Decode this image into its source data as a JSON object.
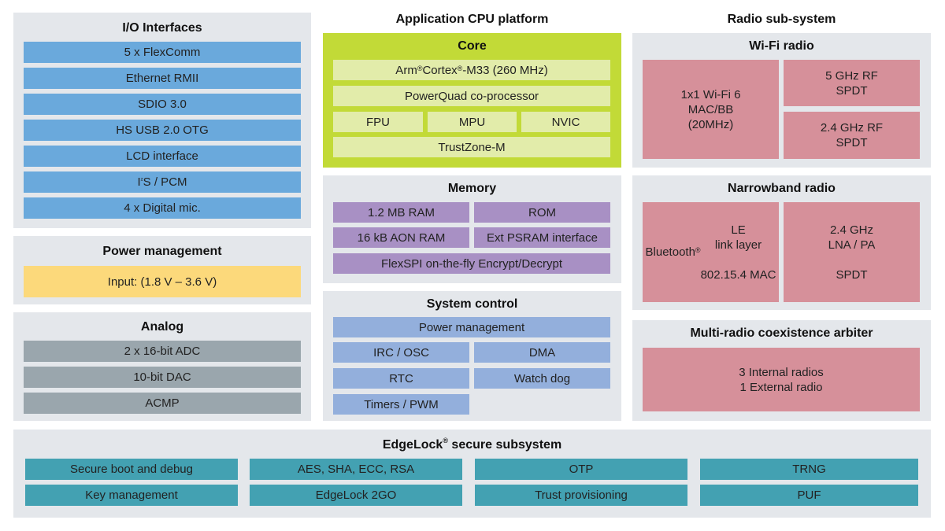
{
  "columns": {
    "middle_title": "Application CPU platform",
    "right_title": "Radio sub-system"
  },
  "io_interfaces": {
    "title": "I/O Interfaces",
    "items": [
      "5 x FlexComm",
      "Ethernet RMII",
      "SDIO 3.0",
      "HS USB 2.0 OTG",
      "LCD interface",
      "I²S / PCM",
      "4 x Digital mic."
    ]
  },
  "power_management": {
    "title": "Power management",
    "items": [
      "Input: (1.8 V – 3.6 V)"
    ]
  },
  "analog": {
    "title": "Analog",
    "items": [
      "2 x 16-bit ADC",
      "10-bit DAC",
      "ACMP"
    ]
  },
  "core": {
    "title": "Core",
    "cpu": "Arm® Cortex®-M33 (260 MHz)",
    "coprocessor": "PowerQuad co-processor",
    "units": [
      "FPU",
      "MPU",
      "NVIC"
    ],
    "security": "TrustZone-M"
  },
  "memory": {
    "title": "Memory",
    "items": [
      "1.2 MB RAM",
      "ROM",
      "16 kB AON RAM",
      "Ext PSRAM interface",
      "FlexSPI  on-the-fly Encrypt/Decrypt"
    ]
  },
  "system_control": {
    "title": "System control",
    "items": [
      "Power management",
      "IRC / OSC",
      "DMA",
      "RTC",
      "Watch dog",
      "Timers / PWM"
    ]
  },
  "wifi_radio": {
    "title": "Wi-Fi radio",
    "mac": "1x1 Wi-Fi 6\nMAC/BB\n(20MHz)",
    "rf5": "5 GHz RF\nSPDT",
    "rf24": "2.4 GHz RF\nSPDT"
  },
  "narrowband_radio": {
    "title": "Narrowband radio",
    "left": "Bluetooth® LE\nlink layer\n\n802.15.4 MAC",
    "right": "2.4 GHz\nLNA / PA\n\nSPDT"
  },
  "coexistence": {
    "title": "Multi-radio coexistence arbiter",
    "body": "3 Internal radios\n1 External radio"
  },
  "edgelock": {
    "title": "EdgeLock® secure subsystem",
    "items": [
      "Secure boot and debug",
      "AES, SHA, ECC, RSA",
      "OTP",
      "TRNG",
      "Key management",
      "EdgeLock 2GO",
      "Trust provisioning",
      "PUF"
    ]
  },
  "colors": {
    "panel": "#e4e7eb",
    "io": "#6aa9dc",
    "power": "#fcd97b",
    "analog": "#9aa6ad",
    "core": "#c2da37",
    "core_block": "#e2ecaa",
    "memory": "#a890c4",
    "system_control": "#93afdc",
    "radio": "#d6909a",
    "security": "#43a1b2"
  }
}
